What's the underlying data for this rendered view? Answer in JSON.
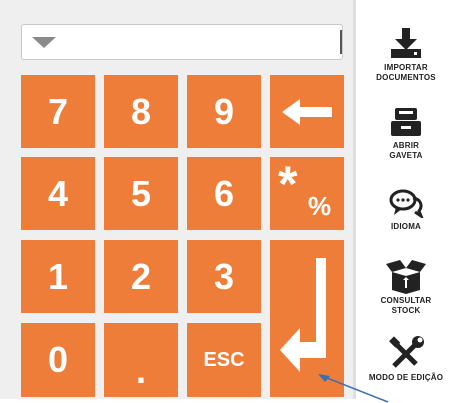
{
  "input": {
    "value": ""
  },
  "keypad": {
    "k7": "7",
    "k8": "8",
    "k9": "9",
    "k4": "4",
    "k5": "5",
    "k6": "6",
    "k1": "1",
    "k2": "2",
    "k3": "3",
    "k0": "0",
    "dot": ".",
    "esc": "ESC",
    "percent_star": "*",
    "percent_sign": "%"
  },
  "sidebar": {
    "import_line1": "IMPORTAR",
    "import_line2": "DOCUMENTOS",
    "drawer_line1": "ABRIR",
    "drawer_line2": "GAVETA",
    "language": "IDIOMA",
    "stock_line1": "CONSULTAR",
    "stock_line2": "STOCK",
    "edit_mode": "MODO DE EDIÇÃO"
  },
  "colors": {
    "key_orange": "#ee7d3a",
    "panel_gray": "#efefef",
    "icon_dark": "#222222",
    "pointer_blue": "#3a6fb0"
  },
  "icons": [
    "dropdown-icon",
    "backspace-arrow-icon",
    "enter-arrow-icon",
    "download-icon",
    "cash-drawer-icon",
    "chat-bubbles-icon",
    "open-box-icon",
    "tools-icon"
  ]
}
